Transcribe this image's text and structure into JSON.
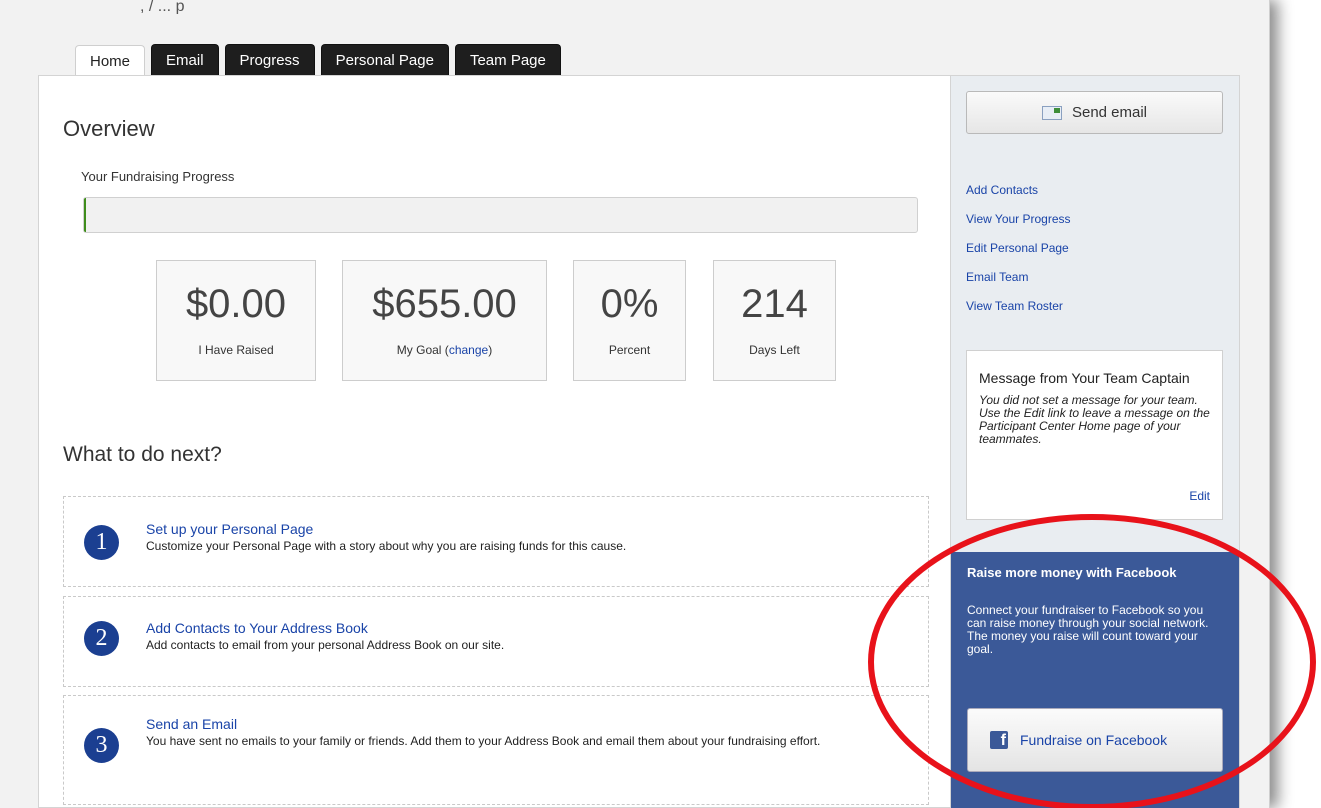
{
  "top_fragment": ", / ... p",
  "tabs": [
    {
      "label": "Home",
      "active": true
    },
    {
      "label": "Email",
      "active": false
    },
    {
      "label": "Progress",
      "active": false
    },
    {
      "label": "Personal Page",
      "active": false
    },
    {
      "label": "Team Page",
      "active": false
    }
  ],
  "overview": {
    "title": "Overview",
    "progress_label": "Your Fundraising Progress",
    "progress_fraction": 0,
    "stats": [
      {
        "value": "$0.00",
        "caption": "I Have Raised"
      },
      {
        "value": "$655.00",
        "caption_prefix": "My Goal (",
        "caption_link": "change",
        "caption_suffix": ")"
      },
      {
        "value": "0%",
        "caption": "Percent"
      },
      {
        "value": "214",
        "caption": "Days Left"
      }
    ]
  },
  "next": {
    "title": "What to do next?",
    "steps": [
      {
        "number": "1",
        "title": "Set up your Personal Page",
        "desc": "Customize your Personal Page with a story about why you are raising funds for this cause."
      },
      {
        "number": "2",
        "title": "Add Contacts to Your Address Book",
        "desc": "Add contacts to email from your personal Address Book on our site."
      },
      {
        "number": "3",
        "title": "Send an Email",
        "desc": "You have sent no emails to your family or friends. Add them to your Address Book and email them about your fundraising effort."
      }
    ]
  },
  "sidebar": {
    "send_email_label": "Send email",
    "links": [
      "Add Contacts",
      "View Your Progress",
      "Edit Personal Page",
      "Email Team",
      "View Team Roster"
    ],
    "captain": {
      "title": "Message from Your Team Captain",
      "message": "You did not set a message for your team. Use the Edit link to leave a message on the Participant Center Home page of your teammates.",
      "edit_label": "Edit"
    },
    "facebook": {
      "title": "Raise more money with Facebook",
      "desc": "Connect your fundraiser to Facebook so you can raise money through your social network. The money you raise will count toward your goal.",
      "button_label": "Fundraise on Facebook",
      "icon_glyph": "f"
    }
  },
  "colors": {
    "tab_dark": "#1e1e1e",
    "link_blue": "#1a44a8",
    "step_badge": "#1b3f91",
    "facebook_blue": "#3b5998",
    "annotation_red": "#e8121a",
    "progress_green": "#5aa92f"
  }
}
